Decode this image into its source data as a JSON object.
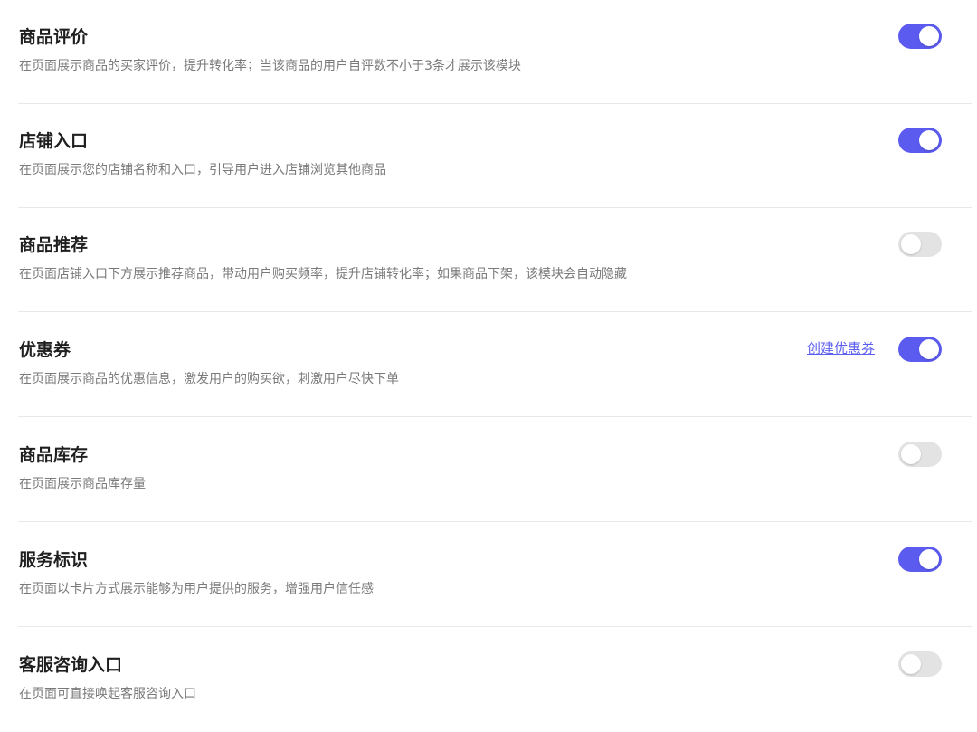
{
  "settings": [
    {
      "title": "商品评价",
      "description": "在页面展示商品的买家评价，提升转化率；当该商品的用户自评数不小于3条才展示该模块",
      "enabled": true
    },
    {
      "title": "店铺入口",
      "description": "在页面展示您的店铺名称和入口，引导用户进入店铺浏览其他商品",
      "enabled": true
    },
    {
      "title": "商品推荐",
      "description": "在页面店铺入口下方展示推荐商品，带动用户购买频率，提升店铺转化率；如果商品下架，该模块会自动隐藏",
      "enabled": false
    },
    {
      "title": "优惠券",
      "description": "在页面展示商品的优惠信息，激发用户的购买欲，刺激用户尽快下单",
      "enabled": true,
      "link_label": "创建优惠券"
    },
    {
      "title": "商品库存",
      "description": "在页面展示商品库存量",
      "enabled": false
    },
    {
      "title": "服务标识",
      "description": "在页面以卡片方式展示能够为用户提供的服务，增强用户信任感",
      "enabled": true
    },
    {
      "title": "客服咨询入口",
      "description": "在页面可直接唤起客服咨询入口",
      "enabled": false
    }
  ],
  "colors": {
    "toggle_on": "#5b5bf0",
    "toggle_off": "#e3e3e3",
    "link": "#5b5ef0"
  }
}
